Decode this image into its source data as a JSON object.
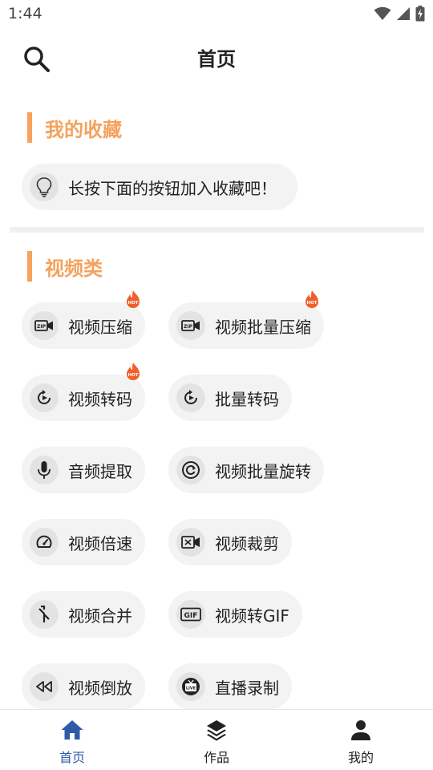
{
  "status": {
    "time": "1:44"
  },
  "header": {
    "title": "首页"
  },
  "favorites": {
    "title": "我的收藏",
    "tip": "长按下面的按钮加入收藏吧！"
  },
  "video": {
    "title": "视频类",
    "items": [
      {
        "label": "视频压缩",
        "icon": "zip-video-icon",
        "hot": true
      },
      {
        "label": "视频批量压缩",
        "icon": "zip-video-icon",
        "hot": true
      },
      {
        "label": "视频转码",
        "icon": "transcode-icon",
        "hot": true
      },
      {
        "label": "批量转码",
        "icon": "transcode-icon",
        "hot": false
      },
      {
        "label": "音频提取",
        "icon": "microphone-icon",
        "hot": false
      },
      {
        "label": "视频批量旋转",
        "icon": "rotate-icon",
        "hot": false
      },
      {
        "label": "视频倍速",
        "icon": "speedometer-icon",
        "hot": false
      },
      {
        "label": "视频裁剪",
        "icon": "crop-video-icon",
        "hot": false
      },
      {
        "label": "视频合并",
        "icon": "merge-icon",
        "hot": false
      },
      {
        "label": "视频转GIF",
        "icon": "gif-icon",
        "hot": false
      },
      {
        "label": "视频倒放",
        "icon": "rewind-icon",
        "hot": false
      },
      {
        "label": "直播录制",
        "icon": "live-tv-icon",
        "hot": false
      }
    ]
  },
  "nav": {
    "items": [
      {
        "label": "首页",
        "icon": "home-icon",
        "active": true
      },
      {
        "label": "作品",
        "icon": "layers-icon",
        "active": false
      },
      {
        "label": "我的",
        "icon": "person-icon",
        "active": false
      }
    ]
  },
  "colors": {
    "accent": "#f5a25d",
    "nav_active": "#2f5aa8",
    "pill_bg": "#f3f3f3",
    "hot": "#f0602a"
  }
}
